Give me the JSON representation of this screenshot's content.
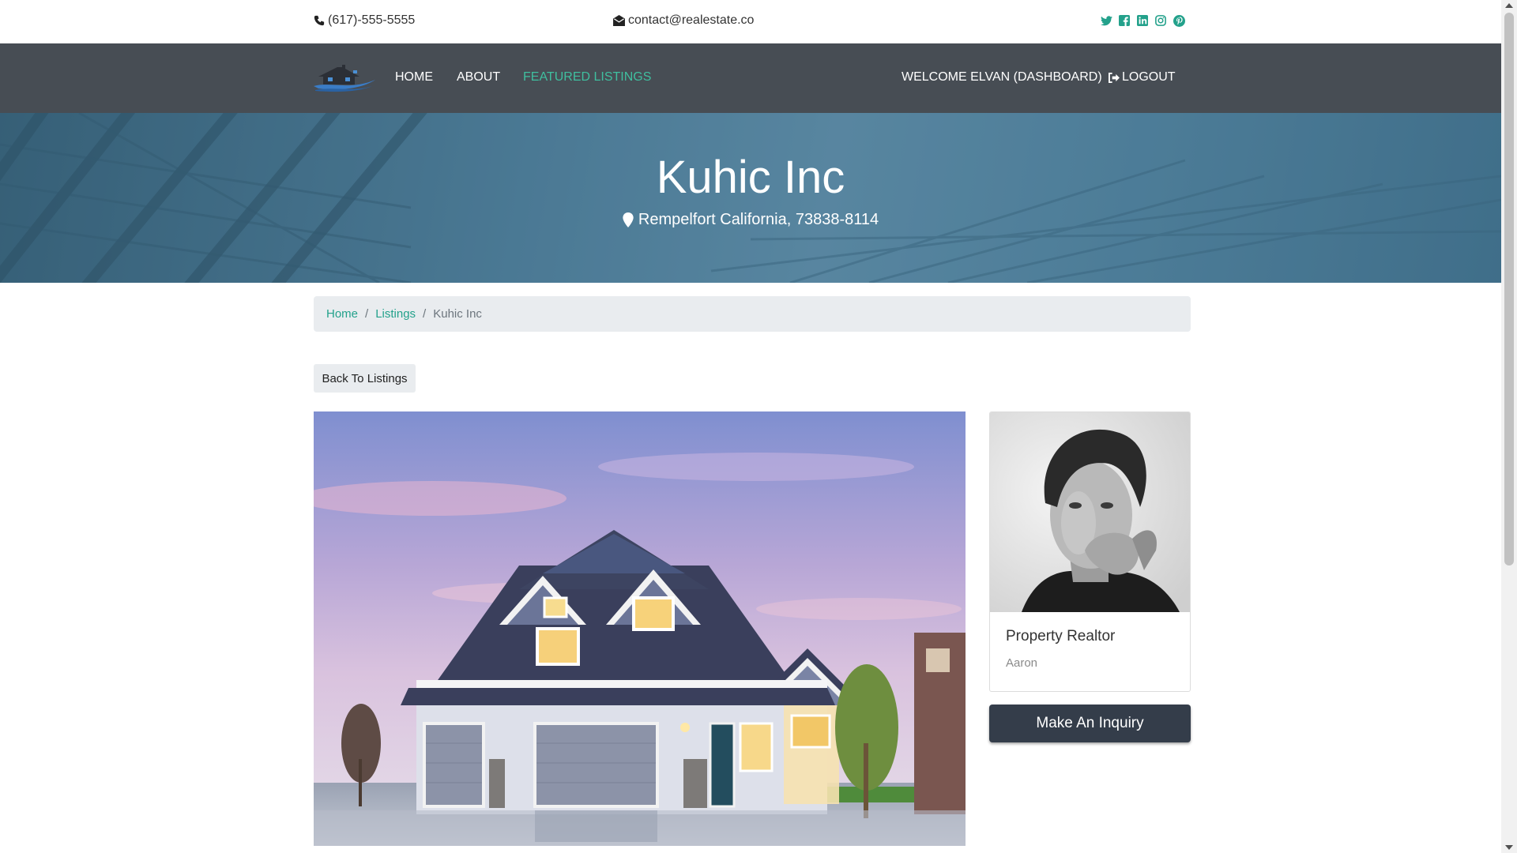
{
  "topbar": {
    "phone": "(617)-555-5555",
    "email": "contact@realestate.co",
    "socials": [
      "twitter-icon",
      "facebook-icon",
      "linkedin-icon",
      "instagram-icon",
      "pinterest-icon"
    ]
  },
  "nav": {
    "home": "HOME",
    "about": "ABOUT",
    "featured": "FEATURED LISTINGS",
    "welcome": "WELCOME ELVAN (DASHBOARD)",
    "logout": "LOGOUT"
  },
  "hero": {
    "title": "Kuhic Inc",
    "address": "Rempelfort California, 73838-8114"
  },
  "breadcrumb": {
    "home": "Home",
    "listings": "Listings",
    "current": "Kuhic Inc"
  },
  "back_button": "Back To Listings",
  "realtor": {
    "role": "Property Realtor",
    "name": "Aaron"
  },
  "inquiry_button": "Make An Inquiry",
  "colors": {
    "accent": "#23a18b",
    "nav_bg": "#474d54",
    "button_dark": "#343d4a"
  }
}
